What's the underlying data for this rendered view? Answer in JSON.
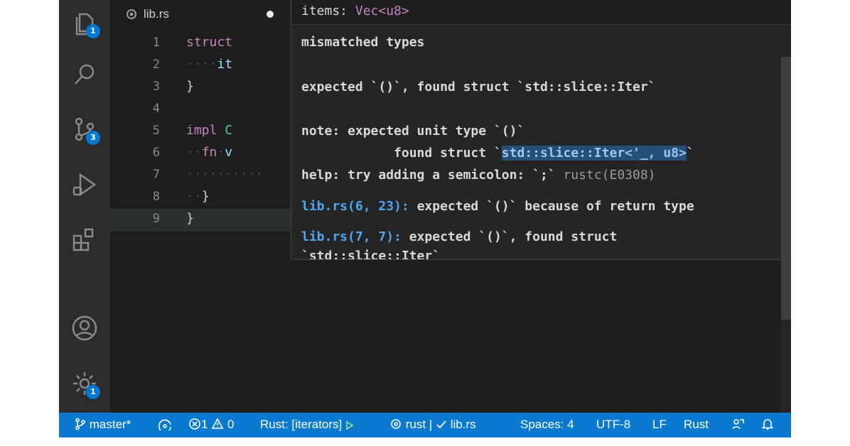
{
  "activity_bar": {
    "explorer_badge": "1",
    "source_control_badge": "3",
    "settings_badge": "1"
  },
  "tab": {
    "filename": "lib.rs"
  },
  "editor": {
    "line_numbers": [
      "1",
      "2",
      "3",
      "4",
      "5",
      "6",
      "7",
      "8",
      "9"
    ],
    "line1": {
      "kw": "struct"
    },
    "line2": {
      "text": "it"
    },
    "line3": {
      "text": "}"
    },
    "line5": {
      "kw": "impl",
      "type": "C"
    },
    "line6": {
      "kw": "fn",
      "text": "v"
    },
    "line8": {
      "text": "}"
    },
    "line9": {
      "text": "}"
    }
  },
  "hover": {
    "signature_name": "items:",
    "signature_type": "Vec<u8>",
    "title": "mismatched types",
    "expected": "expected `()`, found struct `std::slice::Iter`",
    "note": "note: expected unit type `()`",
    "found_prefix": "            found struct `",
    "found_selected": "std::slice::Iter<'_, u8>",
    "found_suffix": "`",
    "help": "help: try adding a semicolon: `;`",
    "code": "rustc(E0308)",
    "related1_link": "lib.rs(6, 23):",
    "related1_text": "expected `()` because of return type",
    "related2_link": "lib.rs(7, 7):",
    "related2_text": "expected `()`, found struct",
    "related2_cont": "`std::slice::Iter`"
  },
  "status_bar": {
    "branch": "master*",
    "errors": "1",
    "warnings": "0",
    "task": "Rust: [iterators]",
    "rust_label": "rust |",
    "check_file": "lib.rs",
    "spaces": "Spaces: 4",
    "encoding": "UTF-8",
    "eol": "LF",
    "language": "Rust"
  },
  "colors": {
    "status_bar": "#0a7ad1",
    "editor_bg": "#1e1e1e",
    "keyword": "#c586c0",
    "link": "#4fa6f4",
    "selection": "#264f78"
  }
}
